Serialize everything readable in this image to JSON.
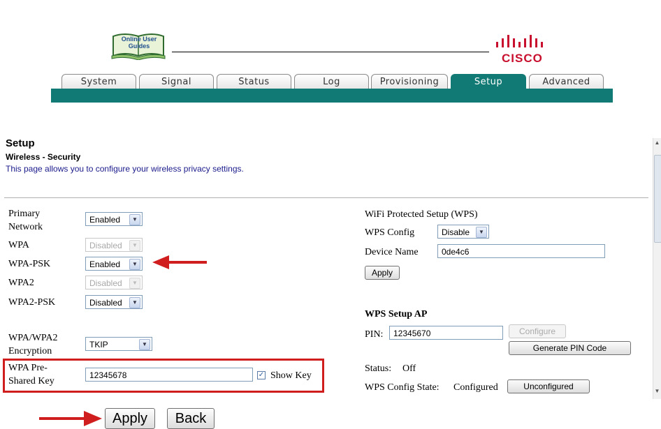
{
  "header": {
    "logo_text": "Online User Guides",
    "brand": "CISCO"
  },
  "tabs": [
    "System",
    "Signal",
    "Status",
    "Log",
    "Provisioning",
    "Setup",
    "Advanced"
  ],
  "active_tab": "Setup",
  "page": {
    "title": "Setup",
    "subtitle": "Wireless - Security",
    "description": "This page allows you to configure your wireless privacy settings."
  },
  "form": {
    "primary_network": {
      "label": "Primary Network",
      "value": "Enabled"
    },
    "wpa": {
      "label": "WPA",
      "value": "Disabled"
    },
    "wpa_psk": {
      "label": "WPA-PSK",
      "value": "Enabled"
    },
    "wpa2": {
      "label": "WPA2",
      "value": "Disabled"
    },
    "wpa2_psk": {
      "label": "WPA2-PSK",
      "value": "Disabled"
    },
    "encryption": {
      "label": "WPA/WPA2 Encryption",
      "value": "TKIP"
    },
    "pre_shared_key": {
      "label": "WPA Pre-Shared Key",
      "value": "12345678",
      "show_key_label": "Show Key",
      "show_key_checked": true
    }
  },
  "wps": {
    "heading": "WiFi Protected Setup (WPS)",
    "config_label": "WPS Config",
    "config_value": "Disable",
    "device_name_label": "Device Name",
    "device_name_value": "0de4c6",
    "apply_label": "Apply"
  },
  "wps_ap": {
    "heading": "WPS Setup AP",
    "pin_label": "PIN:",
    "pin_value": "12345670",
    "configure_label": "Configure",
    "generate_label": "Generate PIN Code",
    "status_label": "Status:",
    "status_value": "Off",
    "config_state_label": "WPS Config State:",
    "config_state_value": "Configured",
    "unconfigured_label": "Unconfigured"
  },
  "actions": {
    "apply_label": "Apply",
    "back_label": "Back"
  },
  "colors": {
    "teal": "#127a75",
    "annotation_red": "#d01e1e",
    "cisco_red": "#c8102e"
  }
}
